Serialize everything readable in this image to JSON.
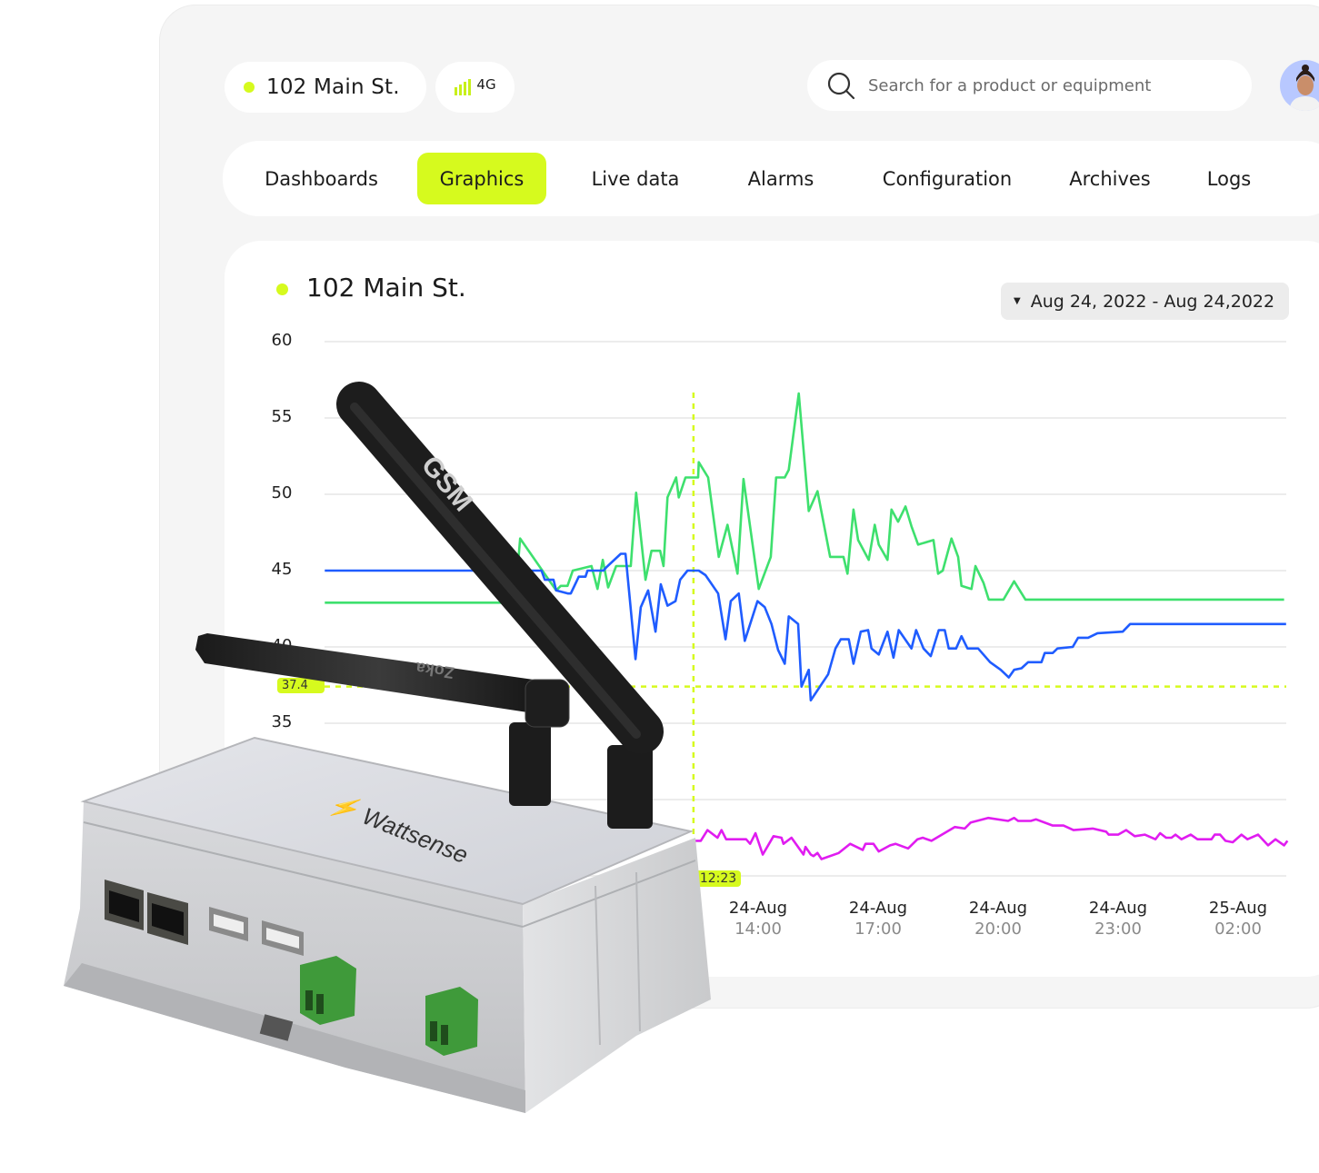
{
  "header": {
    "location_name": "102 Main St.",
    "network_label": "4G",
    "search_placeholder": "Search for a product or equipment",
    "status_color": "#d6fa1e"
  },
  "tabs": [
    {
      "label": "Dashboards",
      "active": false
    },
    {
      "label": "Graphics",
      "active": true
    },
    {
      "label": "Live data",
      "active": false
    },
    {
      "label": "Alarms",
      "active": false
    },
    {
      "label": "Configuration",
      "active": false
    },
    {
      "label": "Archives",
      "active": false
    },
    {
      "label": "Logs",
      "active": false
    }
  ],
  "card": {
    "title": "102 Main St.",
    "date_range": "Aug 24, 2022 - Aug 24,2022"
  },
  "device": {
    "brand": "Wattsense",
    "antenna_1_label": "GSM",
    "antenna_2_label": "Zoka"
  },
  "chart_data": {
    "type": "line",
    "y_ticks": [
      60,
      55,
      50,
      45,
      40,
      35
    ],
    "ylim": [
      25,
      60
    ],
    "grid": true,
    "x_ticks": [
      {
        "date": "24-Aug",
        "time": "14:00"
      },
      {
        "date": "24-Aug",
        "time": "17:00"
      },
      {
        "date": "24-Aug",
        "time": "20:00"
      },
      {
        "date": "24-Aug",
        "time": "23:00"
      },
      {
        "date": "25-Aug",
        "time": "02:00"
      }
    ],
    "crosshair": {
      "x_label": "12:23",
      "x": "24-Aug 12:23",
      "y_label": "37.4",
      "y": 37.4,
      "color": "#d6fa1e"
    },
    "series": [
      {
        "color": "#3ee06e",
        "points": [
          [
            "24-Aug 03:10",
            42.9
          ],
          [
            "24-Aug 07:19",
            42.9
          ],
          [
            "24-Aug 07:55",
            42.9
          ],
          [
            "24-Aug 08:03",
            47.1
          ],
          [
            "24-Aug 08:57",
            43.7
          ],
          [
            "24-Aug 09:04",
            44.0
          ],
          [
            "24-Aug 09:14",
            44.0
          ],
          [
            "24-Aug 09:22",
            45.0
          ],
          [
            "24-Aug 09:50",
            45.3
          ],
          [
            "24-Aug 09:59",
            43.8
          ],
          [
            "24-Aug 10:07",
            45.7
          ],
          [
            "24-Aug 10:15",
            43.9
          ],
          [
            "24-Aug 10:27",
            45.3
          ],
          [
            "24-Aug 10:49",
            45.3
          ],
          [
            "24-Aug 10:57",
            50.1
          ],
          [
            "24-Aug 11:11",
            44.4
          ],
          [
            "24-Aug 11:20",
            46.3
          ],
          [
            "24-Aug 11:33",
            46.3
          ],
          [
            "24-Aug 11:38",
            45.3
          ],
          [
            "24-Aug 11:44",
            49.8
          ],
          [
            "24-Aug 11:57",
            51.1
          ],
          [
            "24-Aug 12:01",
            49.8
          ],
          [
            "24-Aug 12:11",
            51.1
          ],
          [
            "24-Aug 12:30",
            51.1
          ],
          [
            "24-Aug 12:31",
            52.1
          ],
          [
            "24-Aug 12:45",
            51.1
          ],
          [
            "24-Aug 13:01",
            45.9
          ],
          [
            "24-Aug 13:14",
            48.0
          ],
          [
            "24-Aug 13:29",
            44.8
          ],
          [
            "24-Aug 13:38",
            51.0
          ],
          [
            "24-Aug 14:01",
            43.8
          ],
          [
            "24-Aug 14:19",
            45.9
          ],
          [
            "24-Aug 14:27",
            51.1
          ],
          [
            "24-Aug 14:40",
            51.1
          ],
          [
            "24-Aug 14:46",
            51.6
          ],
          [
            "24-Aug 15:01",
            56.6
          ],
          [
            "24-Aug 15:16",
            48.9
          ],
          [
            "24-Aug 15:29",
            50.2
          ],
          [
            "24-Aug 15:48",
            45.9
          ],
          [
            "24-Aug 16:08",
            45.9
          ],
          [
            "24-Aug 16:14",
            44.8
          ],
          [
            "24-Aug 16:23",
            49.0
          ],
          [
            "24-Aug 16:30",
            47.0
          ],
          [
            "24-Aug 16:46",
            45.7
          ],
          [
            "24-Aug 16:55",
            48.0
          ],
          [
            "24-Aug 17:01",
            46.7
          ],
          [
            "24-Aug 17:14",
            45.7
          ],
          [
            "24-Aug 17:20",
            49.0
          ],
          [
            "24-Aug 17:30",
            48.2
          ],
          [
            "24-Aug 17:41",
            49.2
          ],
          [
            "24-Aug 17:50",
            47.9
          ],
          [
            "24-Aug 18:00",
            46.7
          ],
          [
            "24-Aug 18:23",
            47.0
          ],
          [
            "24-Aug 18:30",
            44.8
          ],
          [
            "24-Aug 18:37",
            45.0
          ],
          [
            "24-Aug 18:50",
            47.1
          ],
          [
            "24-Aug 19:00",
            45.9
          ],
          [
            "24-Aug 19:05",
            44.0
          ],
          [
            "24-Aug 19:20",
            43.8
          ],
          [
            "24-Aug 19:26",
            45.3
          ],
          [
            "24-Aug 19:38",
            44.2
          ],
          [
            "24-Aug 19:46",
            43.1
          ],
          [
            "24-Aug 20:08",
            43.1
          ],
          [
            "24-Aug 20:24",
            44.3
          ],
          [
            "24-Aug 20:41",
            43.1
          ],
          [
            "25-Aug 03:09",
            43.1
          ]
        ]
      },
      {
        "color": "#1f5cff",
        "points": [
          [
            "24-Aug 03:10",
            45.0
          ],
          [
            "24-Aug 08:35",
            45.0
          ],
          [
            "24-Aug 08:40",
            44.4
          ],
          [
            "24-Aug 08:53",
            44.4
          ],
          [
            "24-Aug 08:57",
            43.7
          ],
          [
            "24-Aug 09:15",
            43.5
          ],
          [
            "24-Aug 09:19",
            43.5
          ],
          [
            "24-Aug 09:31",
            44.6
          ],
          [
            "24-Aug 09:41",
            44.6
          ],
          [
            "24-Aug 09:44",
            45.0
          ],
          [
            "24-Aug 10:08",
            45.0
          ],
          [
            "24-Aug 10:12",
            45.2
          ],
          [
            "24-Aug 10:34",
            46.1
          ],
          [
            "24-Aug 10:41",
            46.1
          ],
          [
            "24-Aug 10:56",
            39.2
          ],
          [
            "24-Aug 11:04",
            42.6
          ],
          [
            "24-Aug 11:15",
            43.7
          ],
          [
            "24-Aug 11:26",
            41.0
          ],
          [
            "24-Aug 11:34",
            44.1
          ],
          [
            "24-Aug 11:44",
            42.7
          ],
          [
            "24-Aug 11:56",
            43.0
          ],
          [
            "24-Aug 12:03",
            44.4
          ],
          [
            "24-Aug 12:14",
            45.0
          ],
          [
            "24-Aug 12:31",
            45.0
          ],
          [
            "24-Aug 12:41",
            44.7
          ],
          [
            "24-Aug 13:00",
            43.5
          ],
          [
            "24-Aug 13:11",
            40.5
          ],
          [
            "24-Aug 13:19",
            43.0
          ],
          [
            "24-Aug 13:31",
            43.5
          ],
          [
            "24-Aug 13:40",
            40.4
          ],
          [
            "24-Aug 13:59",
            43.0
          ],
          [
            "24-Aug 14:10",
            42.6
          ],
          [
            "24-Aug 14:20",
            41.5
          ],
          [
            "24-Aug 14:30",
            39.8
          ],
          [
            "24-Aug 14:40",
            38.9
          ],
          [
            "24-Aug 14:46",
            42.0
          ],
          [
            "24-Aug 15:00",
            41.5
          ],
          [
            "24-Aug 15:05",
            37.4
          ],
          [
            "24-Aug 15:16",
            38.5
          ],
          [
            "24-Aug 15:19",
            36.5
          ],
          [
            "24-Aug 15:45",
            38.2
          ],
          [
            "24-Aug 15:56",
            39.9
          ],
          [
            "24-Aug 16:04",
            40.5
          ],
          [
            "24-Aug 16:16",
            40.5
          ],
          [
            "24-Aug 16:23",
            38.9
          ],
          [
            "24-Aug 16:34",
            41.0
          ],
          [
            "24-Aug 16:45",
            41.1
          ],
          [
            "24-Aug 16:50",
            39.9
          ],
          [
            "24-Aug 17:01",
            39.5
          ],
          [
            "24-Aug 17:14",
            41.0
          ],
          [
            "24-Aug 17:23",
            39.3
          ],
          [
            "24-Aug 17:31",
            41.1
          ],
          [
            "24-Aug 17:50",
            39.9
          ],
          [
            "24-Aug 17:57",
            41.1
          ],
          [
            "24-Aug 18:08",
            39.9
          ],
          [
            "24-Aug 18:19",
            39.4
          ],
          [
            "24-Aug 18:31",
            41.1
          ],
          [
            "24-Aug 18:40",
            41.1
          ],
          [
            "24-Aug 18:46",
            39.9
          ],
          [
            "24-Aug 18:57",
            39.9
          ],
          [
            "24-Aug 19:05",
            40.7
          ],
          [
            "24-Aug 19:14",
            39.9
          ],
          [
            "24-Aug 19:30",
            39.9
          ],
          [
            "24-Aug 19:48",
            39.0
          ],
          [
            "24-Aug 20:04",
            38.5
          ],
          [
            "24-Aug 20:16",
            38.0
          ],
          [
            "24-Aug 20:24",
            38.5
          ],
          [
            "24-Aug 20:35",
            38.6
          ],
          [
            "24-Aug 20:45",
            39.0
          ],
          [
            "24-Aug 21:05",
            39.0
          ],
          [
            "24-Aug 21:10",
            39.6
          ],
          [
            "24-Aug 21:22",
            39.6
          ],
          [
            "24-Aug 21:29",
            39.9
          ],
          [
            "24-Aug 21:52",
            40.0
          ],
          [
            "24-Aug 22:00",
            40.6
          ],
          [
            "24-Aug 22:15",
            40.6
          ],
          [
            "24-Aug 22:29",
            40.9
          ],
          [
            "24-Aug 23:07",
            41.0
          ],
          [
            "24-Aug 23:18",
            41.5
          ],
          [
            "25-Aug 03:12",
            41.5
          ]
        ]
      },
      {
        "color": "#e01cf0",
        "points": [
          [
            "24-Aug 12:25",
            27.3
          ],
          [
            "24-Aug 12:34",
            27.3
          ],
          [
            "24-Aug 12:44",
            28.0
          ],
          [
            "24-Aug 12:59",
            27.5
          ],
          [
            "24-Aug 13:05",
            28.0
          ],
          [
            "24-Aug 13:12",
            27.4
          ],
          [
            "24-Aug 13:42",
            27.4
          ],
          [
            "24-Aug 13:48",
            27.1
          ],
          [
            "24-Aug 13:56",
            27.8
          ],
          [
            "24-Aug 14:07",
            26.4
          ],
          [
            "24-Aug 14:23",
            27.6
          ],
          [
            "24-Aug 14:35",
            27.5
          ],
          [
            "24-Aug 14:38",
            27.1
          ],
          [
            "24-Aug 14:50",
            27.5
          ],
          [
            "24-Aug 15:08",
            26.4
          ],
          [
            "24-Aug 15:11",
            26.9
          ],
          [
            "24-Aug 15:19",
            26.4
          ],
          [
            "24-Aug 15:23",
            26.3
          ],
          [
            "24-Aug 15:29",
            26.5
          ],
          [
            "24-Aug 15:35",
            26.1
          ],
          [
            "24-Aug 16:01",
            26.5
          ],
          [
            "24-Aug 16:18",
            27.1
          ],
          [
            "24-Aug 16:37",
            26.7
          ],
          [
            "24-Aug 16:41",
            27.1
          ],
          [
            "24-Aug 16:53",
            27.1
          ],
          [
            "24-Aug 17:01",
            26.6
          ],
          [
            "24-Aug 17:18",
            27.0
          ],
          [
            "24-Aug 17:26",
            27.1
          ],
          [
            "24-Aug 17:45",
            26.8
          ],
          [
            "24-Aug 17:59",
            27.4
          ],
          [
            "24-Aug 18:07",
            27.5
          ],
          [
            "24-Aug 18:20",
            27.3
          ],
          [
            "24-Aug 18:55",
            28.2
          ],
          [
            "24-Aug 19:10",
            28.1
          ],
          [
            "24-Aug 19:19",
            28.5
          ],
          [
            "24-Aug 19:45",
            28.8
          ],
          [
            "24-Aug 20:15",
            28.6
          ],
          [
            "24-Aug 20:24",
            28.8
          ],
          [
            "24-Aug 20:30",
            28.6
          ],
          [
            "24-Aug 20:49",
            28.6
          ],
          [
            "24-Aug 20:57",
            28.7
          ],
          [
            "24-Aug 21:22",
            28.3
          ],
          [
            "24-Aug 21:38",
            28.3
          ],
          [
            "24-Aug 21:53",
            28.0
          ],
          [
            "24-Aug 22:22",
            28.1
          ],
          [
            "24-Aug 22:42",
            27.9
          ],
          [
            "24-Aug 22:46",
            27.7
          ],
          [
            "24-Aug 23:00",
            27.7
          ],
          [
            "24-Aug 23:12",
            28.0
          ],
          [
            "24-Aug 23:25",
            27.6
          ],
          [
            "24-Aug 23:40",
            27.7
          ],
          [
            "24-Aug 23:56",
            27.4
          ],
          [
            "25-Aug 00:03",
            27.8
          ],
          [
            "25-Aug 00:12",
            27.5
          ],
          [
            "25-Aug 00:20",
            27.5
          ],
          [
            "25-Aug 00:26",
            27.7
          ],
          [
            "25-Aug 00:35",
            27.4
          ],
          [
            "25-Aug 00:49",
            27.7
          ],
          [
            "25-Aug 00:59",
            27.4
          ],
          [
            "25-Aug 01:20",
            27.4
          ],
          [
            "25-Aug 01:25",
            27.7
          ],
          [
            "25-Aug 01:33",
            27.7
          ],
          [
            "25-Aug 01:41",
            27.3
          ],
          [
            "25-Aug 01:52",
            27.2
          ],
          [
            "25-Aug 02:05",
            27.7
          ],
          [
            "25-Aug 02:14",
            27.4
          ],
          [
            "25-Aug 02:30",
            27.7
          ],
          [
            "25-Aug 02:45",
            27.0
          ],
          [
            "25-Aug 02:56",
            27.4
          ],
          [
            "25-Aug 03:09",
            27.0
          ],
          [
            "25-Aug 03:14",
            27.3
          ]
        ]
      }
    ]
  }
}
